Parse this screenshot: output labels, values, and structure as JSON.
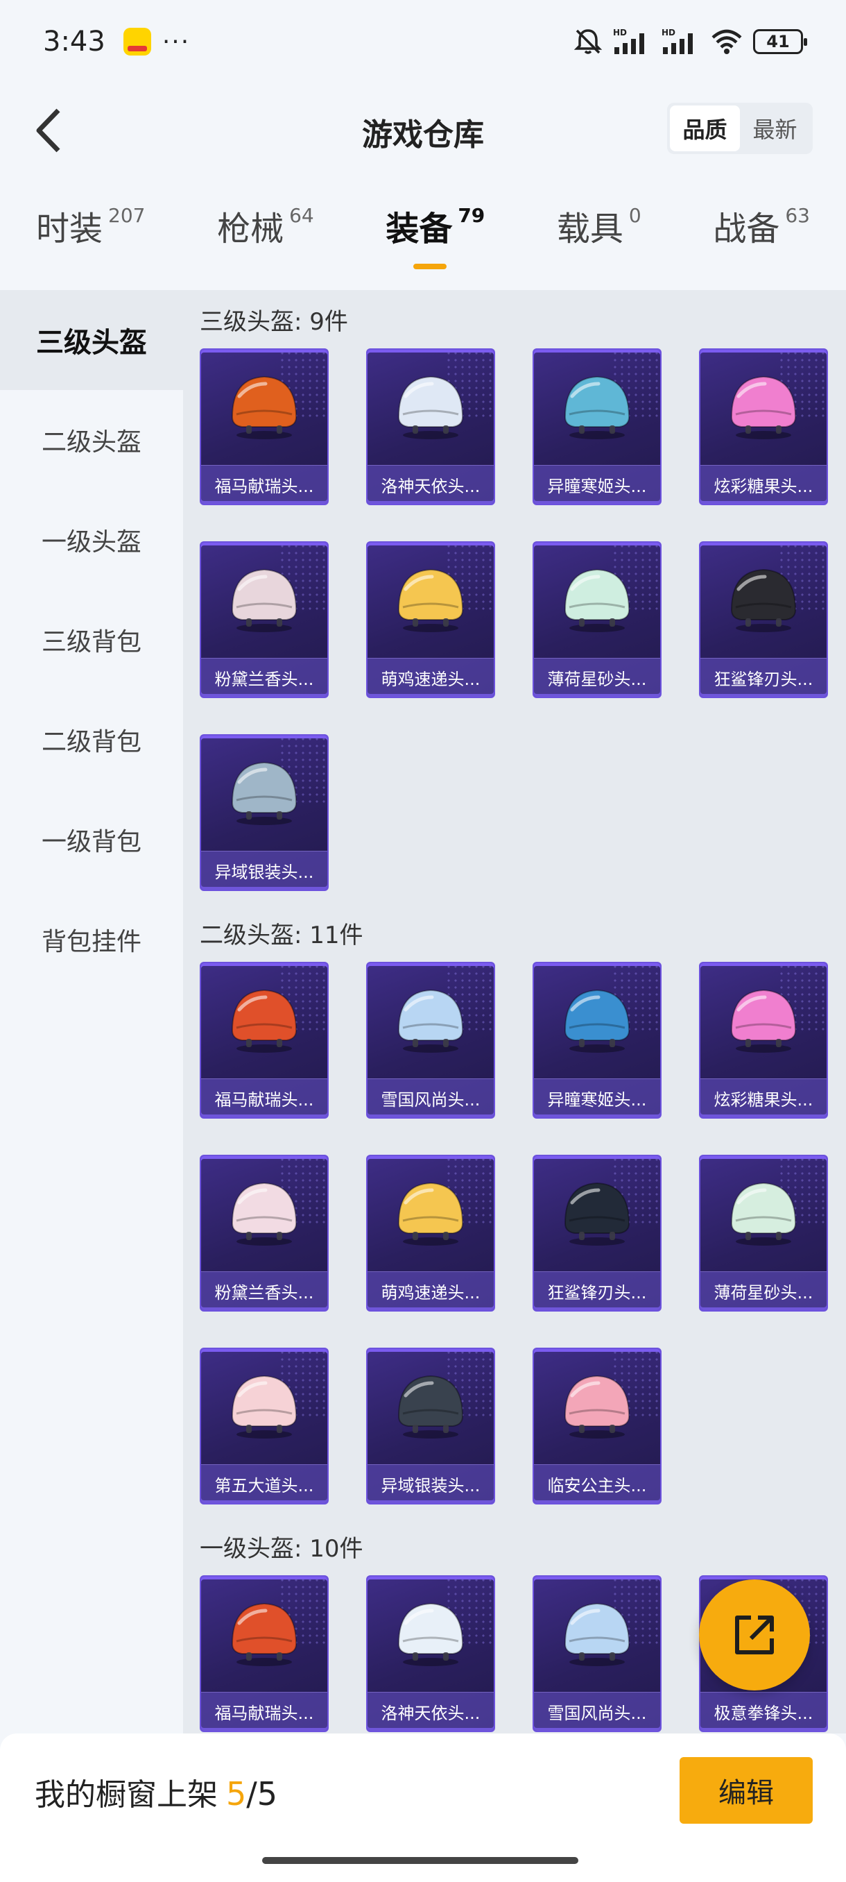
{
  "status_bar": {
    "time": "3:43",
    "dots": "···",
    "battery": "41",
    "icons": [
      "app-notification-icon",
      "mute-icon",
      "signal-hd-icon",
      "signal-hd-icon",
      "wifi-icon",
      "battery-icon"
    ]
  },
  "header": {
    "title": "游戏仓库",
    "sort_options": [
      "品质",
      "最新"
    ],
    "active_sort": "品质"
  },
  "tabs": [
    {
      "label": "时装",
      "count": "207"
    },
    {
      "label": "枪械",
      "count": "64"
    },
    {
      "label": "装备",
      "count": "79",
      "active": true
    },
    {
      "label": "载具",
      "count": "0"
    },
    {
      "label": "战备",
      "count": "63"
    }
  ],
  "sidebar": {
    "items": [
      "三级头盔",
      "二级头盔",
      "一级头盔",
      "三级背包",
      "二级背包",
      "一级背包",
      "背包挂件"
    ],
    "active": "三级头盔"
  },
  "sections": [
    {
      "title": "三级头盔: 9件",
      "items": [
        {
          "label": "福马献瑞头...",
          "color": "#e0601e"
        },
        {
          "label": "洛神天依头...",
          "color": "#dfe8f5"
        },
        {
          "label": "异瞳寒姬头...",
          "color": "#5fb7d6"
        },
        {
          "label": "炫彩糖果头...",
          "color": "#f07fcf"
        },
        {
          "label": "粉黛兰香头...",
          "color": "#e8d6dc"
        },
        {
          "label": "萌鸡速递头...",
          "color": "#f5c650"
        },
        {
          "label": "薄荷星砂头...",
          "color": "#cfeee0"
        },
        {
          "label": "狂鲨锋刃头...",
          "color": "#2a2a30"
        },
        {
          "label": "异域银装头...",
          "color": "#9fb6c8"
        }
      ]
    },
    {
      "title": "二级头盔: 11件",
      "items": [
        {
          "label": "福马献瑞头...",
          "color": "#e0502a"
        },
        {
          "label": "雪国风尚头...",
          "color": "#b8d6f3"
        },
        {
          "label": "异瞳寒姬头...",
          "color": "#3a8fd0"
        },
        {
          "label": "炫彩糖果头...",
          "color": "#f07fcf"
        },
        {
          "label": "粉黛兰香头...",
          "color": "#f2dbe3"
        },
        {
          "label": "萌鸡速递头...",
          "color": "#f5c650"
        },
        {
          "label": "狂鲨锋刃头...",
          "color": "#222a38"
        },
        {
          "label": "薄荷星砂头...",
          "color": "#d6eedf"
        },
        {
          "label": "第五大道头...",
          "color": "#f6d2d6"
        },
        {
          "label": "异域银装头...",
          "color": "#39424e"
        },
        {
          "label": "临安公主头...",
          "color": "#f3a6b8"
        }
      ]
    },
    {
      "title": "一级头盔: 10件",
      "items": [
        {
          "label": "福马献瑞头...",
          "color": "#e0502a"
        },
        {
          "label": "洛神天依头...",
          "color": "#e8f0f8"
        },
        {
          "label": "雪国风尚头...",
          "color": "#b8d6f3"
        },
        {
          "label": "极意拳锋头...",
          "color": "#3a3a44"
        }
      ]
    }
  ],
  "bottom_bar": {
    "label": "我的橱窗上架",
    "count": "5",
    "separator": "/",
    "total": "5",
    "edit_label": "编辑"
  },
  "colors": {
    "accent": "#f7ab0e",
    "card_border": "#6c52dd",
    "card_bg": "#2a1f5e"
  }
}
